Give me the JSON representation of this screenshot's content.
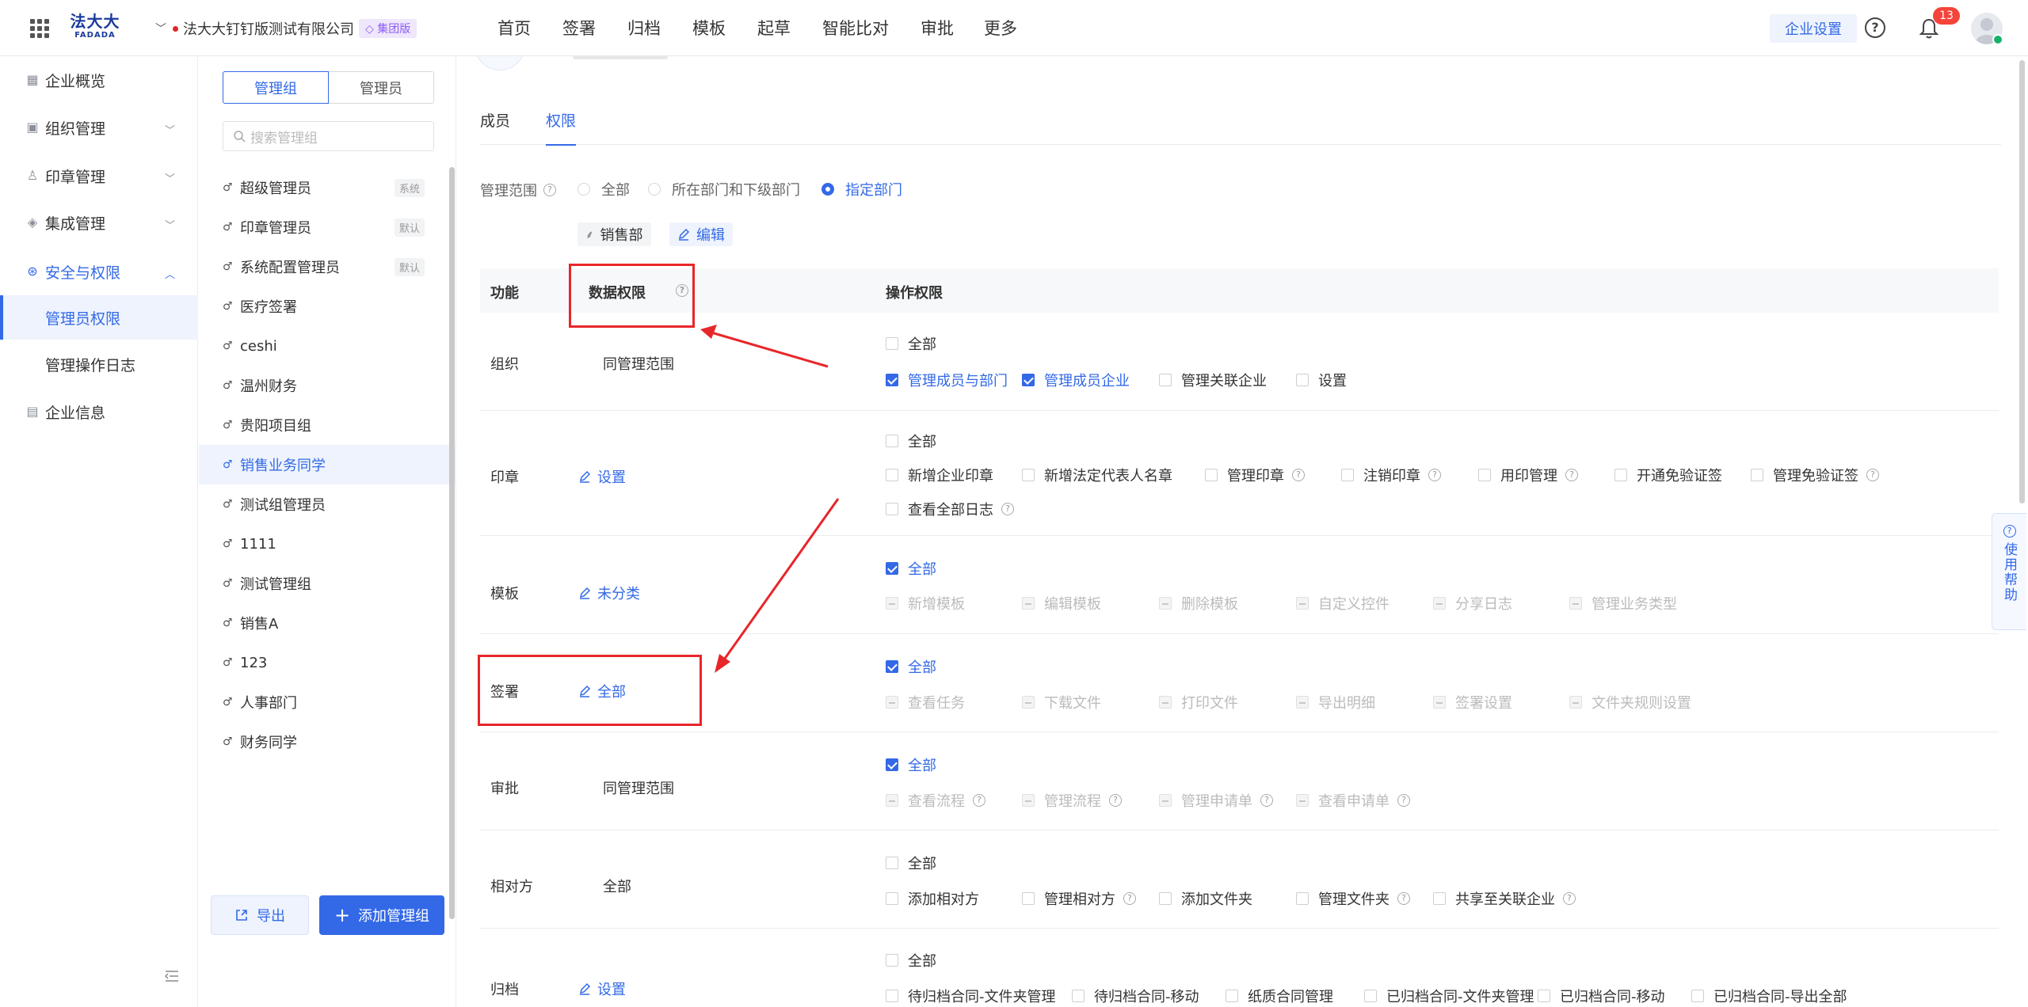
{
  "topbar": {
    "logo_cn": "法大大",
    "logo_en": "FADADA",
    "company": "法大大钉钉版测试有限公司",
    "company_badge": "集团版",
    "nav": [
      "首页",
      "签署",
      "归档",
      "模板",
      "起草",
      "智能比对",
      "审批",
      "更多"
    ],
    "enterprise_settings": "企业设置",
    "notification_count": "13"
  },
  "sidebar": {
    "items": [
      {
        "label": "企业概览",
        "icon": "overview-icon"
      },
      {
        "label": "组织管理",
        "icon": "org-icon"
      },
      {
        "label": "印章管理",
        "icon": "seal-icon"
      },
      {
        "label": "集成管理",
        "icon": "layers-icon"
      },
      {
        "label": "安全与权限",
        "icon": "security-icon"
      },
      {
        "label": "管理员权限",
        "icon": ""
      },
      {
        "label": "管理操作日志",
        "icon": ""
      },
      {
        "label": "企业信息",
        "icon": "info-icon"
      }
    ]
  },
  "mid": {
    "seg": [
      "管理组",
      "管理员"
    ],
    "search_placeholder": "搜索管理组",
    "groups": [
      {
        "label": "超级管理员",
        "tag": "系统"
      },
      {
        "label": "印章管理员",
        "tag": "默认"
      },
      {
        "label": "系统配置管理员",
        "tag": "默认"
      },
      {
        "label": "医疗签署",
        "tag": ""
      },
      {
        "label": "ceshi",
        "tag": ""
      },
      {
        "label": "温州财务",
        "tag": ""
      },
      {
        "label": "贵阳项目组",
        "tag": ""
      },
      {
        "label": "销售业务同学",
        "tag": ""
      },
      {
        "label": "测试组管理员",
        "tag": ""
      },
      {
        "label": "1111",
        "tag": ""
      },
      {
        "label": "测试管理组",
        "tag": ""
      },
      {
        "label": "销售A",
        "tag": ""
      },
      {
        "label": "123",
        "tag": ""
      },
      {
        "label": "人事部门",
        "tag": ""
      },
      {
        "label": "财务同学",
        "tag": ""
      }
    ],
    "export": "导出",
    "add": "添加管理组"
  },
  "main": {
    "tabs": [
      "成员",
      "权限"
    ],
    "scope_label": "管理范围",
    "scope_options": [
      "全部",
      "所在部门和下级部门",
      "指定部门"
    ],
    "scope_selected": "指定部门",
    "dept_chip": "销售部",
    "edit_chip": "编辑",
    "headers": {
      "func": "功能",
      "data": "数据权限",
      "ops": "操作权限"
    },
    "rows": [
      {
        "func": "组织",
        "data": "同管理范围",
        "ops_all": "全部",
        "ops": [
          "管理成员与部门",
          "管理成员企业",
          "管理关联企业",
          "设置"
        ]
      },
      {
        "func": "印章",
        "data": "设置",
        "ops_all": "全部",
        "ops": [
          "新增企业印章",
          "新增法定代表人名章",
          "管理印章",
          "注销印章",
          "用印管理",
          "开通免验证签",
          "管理免验证签",
          "查看全部日志"
        ]
      },
      {
        "func": "模板",
        "data": "未分类",
        "ops_all": "全部",
        "ops": [
          "新增模板",
          "编辑模板",
          "删除模板",
          "自定义控件",
          "分享日志",
          "管理业务类型"
        ]
      },
      {
        "func": "签署",
        "data": "全部",
        "ops_all": "全部",
        "ops": [
          "查看任务",
          "下载文件",
          "打印文件",
          "导出明细",
          "签署设置",
          "文件夹规则设置"
        ]
      },
      {
        "func": "审批",
        "data": "同管理范围",
        "ops_all": "全部",
        "ops": [
          "查看流程",
          "管理流程",
          "管理申请单",
          "查看申请单"
        ]
      },
      {
        "func": "相对方",
        "data": "全部",
        "ops_all": "全部",
        "ops": [
          "添加相对方",
          "管理相对方",
          "添加文件夹",
          "管理文件夹",
          "共享至关联企业"
        ]
      },
      {
        "func": "归档",
        "data": "设置",
        "ops_all": "全部",
        "ops": [
          "待归档合同-文件夹管理",
          "待归档合同-移动",
          "纸质合同管理",
          "已归档合同-文件夹管理",
          "已归档合同-移动",
          "已归档合同-导出全部"
        ]
      }
    ]
  },
  "help_tab": "使用帮助",
  "colors": {
    "accent": "#3369e7",
    "annotation": "#e8262a",
    "badge": "#f5443a"
  }
}
